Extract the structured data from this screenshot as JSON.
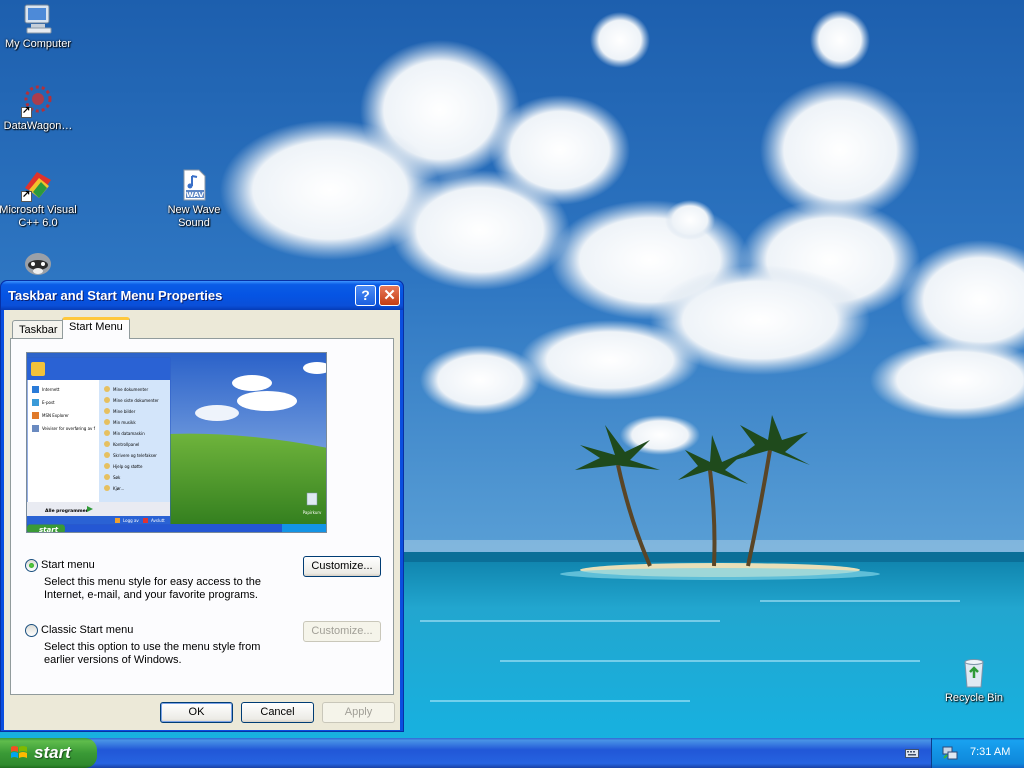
{
  "desktop": {
    "icons": [
      {
        "label": "My Computer",
        "icon": "my-computer-icon"
      },
      {
        "label": "DataWagon…",
        "icon": "datawagon-icon"
      },
      {
        "label": "Microsoft Visual C++ 6.0",
        "icon": "visual-cpp-icon"
      },
      {
        "label": "New Wave Sound",
        "icon": "wav-file-icon"
      },
      {
        "label": "Recycle Bin",
        "icon": "recycle-bin-icon"
      }
    ]
  },
  "window": {
    "title": "Taskbar and Start Menu Properties",
    "help_glyph": "?",
    "close_glyph": "✕",
    "tabs": [
      {
        "label": "Taskbar",
        "active": false
      },
      {
        "label": "Start Menu",
        "active": true
      }
    ],
    "options": [
      {
        "label": "Start menu",
        "checked": true,
        "description": "Select this menu style for easy access to the Internet, e-mail, and your favorite programs.",
        "button": {
          "label": "Customize...",
          "enabled": true
        }
      },
      {
        "label": "Classic Start menu",
        "checked": false,
        "description": "Select this option to use the menu style from earlier versions of Windows.",
        "button": {
          "label": "Customize...",
          "enabled": false
        }
      }
    ],
    "buttons": {
      "ok": "OK",
      "cancel": "Cancel",
      "apply": "Apply"
    },
    "preview": {
      "left_items": [
        "Internett",
        "E-post",
        "MSN Explorer",
        "Veiviser for overføring av filer og innstillinger"
      ],
      "right_items": [
        "Mine dokumenter",
        "Mine siste dokumenter",
        "Mine bilder",
        "Min musikk",
        "Min datamaskin",
        "Kontrollpanel",
        "Skrivere og telefakser",
        "Hjelp og støtte",
        "Søk",
        "Kjør..."
      ],
      "all_programs": "Alle programmer",
      "logoff": "Logg av",
      "shutdown": "Avslutt",
      "start": "start",
      "recycle": "Papirkurv"
    }
  },
  "taskbar": {
    "start_label": "start",
    "clock": "7:31 AM"
  },
  "colors": {
    "xp_blue": "#0a4ee0",
    "start_green": "#3a9a36",
    "tray_blue": "#1394e5",
    "dialog_face": "#ece9d8"
  }
}
